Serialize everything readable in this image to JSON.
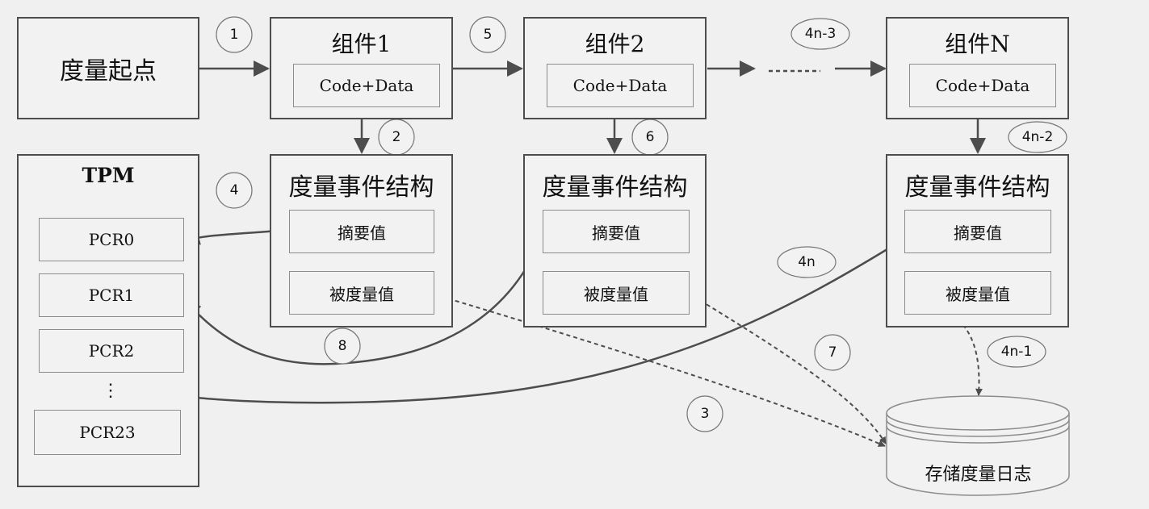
{
  "start": {
    "label": "度量起点"
  },
  "components": [
    {
      "title": "组件1",
      "content": "Code+Data"
    },
    {
      "title": "组件2",
      "content": "Code+Data"
    },
    {
      "title": "组件N",
      "content": "Code+Data"
    }
  ],
  "event_structures": [
    {
      "title": "度量事件结构",
      "digest": "摘要值",
      "measured": "被度量值"
    },
    {
      "title": "度量事件结构",
      "digest": "摘要值",
      "measured": "被度量值"
    },
    {
      "title": "度量事件结构",
      "digest": "摘要值",
      "measured": "被度量值"
    }
  ],
  "tpm": {
    "title": "TPM",
    "pcrs": [
      "PCR0",
      "PCR1",
      "PCR2",
      "PCR23"
    ],
    "ellipsis": "⋮"
  },
  "log_store": {
    "label": "存储度量日志"
  },
  "steps": [
    "1",
    "2",
    "3",
    "4",
    "5",
    "6",
    "7",
    "8",
    "4n-3",
    "4n-2",
    "4n-1",
    "4n"
  ],
  "colors": {
    "line": "#4d4d4d",
    "box_fill": "#f2f2f2",
    "background": "#f0f0f0"
  }
}
